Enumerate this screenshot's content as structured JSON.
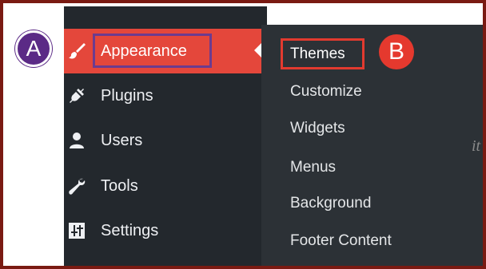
{
  "sidebar": {
    "items": [
      {
        "label": "Appearance",
        "icon": "paintbrush-icon",
        "active": true
      },
      {
        "label": "Plugins",
        "icon": "plugin-plug-icon",
        "active": false
      },
      {
        "label": "Users",
        "icon": "user-icon",
        "active": false
      },
      {
        "label": "Tools",
        "icon": "wrench-icon",
        "active": false
      },
      {
        "label": "Settings",
        "icon": "settings-sliders-icon",
        "active": false
      }
    ]
  },
  "submenu": {
    "items": [
      {
        "label": "Themes",
        "current": true
      },
      {
        "label": "Customize"
      },
      {
        "label": "Widgets"
      },
      {
        "label": "Menus"
      },
      {
        "label": "Background"
      },
      {
        "label": "Footer Content"
      }
    ]
  },
  "annotations": {
    "badge_a": "A",
    "badge_b": "B"
  },
  "content": {
    "hint_text": "it"
  },
  "colors": {
    "sidebar_bg": "#23282d",
    "active_bg": "#e4473b",
    "flyout_bg": "#2c3136",
    "frame": "#7a1a12",
    "badge_a": "#5b2a86",
    "badge_b": "#e5392e",
    "highlight_a": "#6c3b8f",
    "highlight_b": "#e23a2f"
  }
}
